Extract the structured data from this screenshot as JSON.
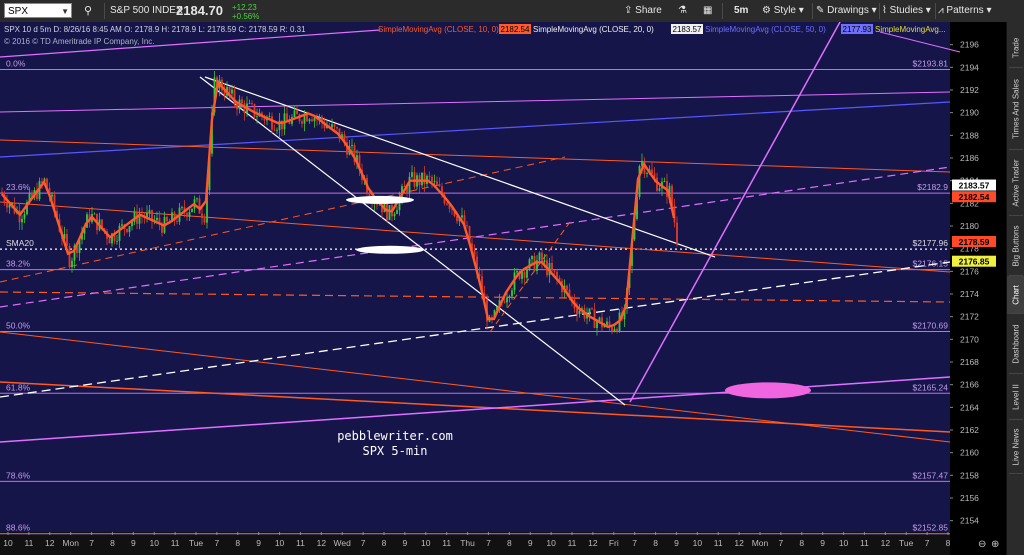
{
  "toolbar": {
    "symbol": "SPX",
    "index_name": "S&P 500 INDEX",
    "last_price": "2184.70",
    "change": "+12.23",
    "change_pct": "+0.56%",
    "share_label": "Share",
    "interval": "5m",
    "style_label": "Style",
    "drawings_label": "Drawings",
    "studies_label": "Studies",
    "patterns_label": "Patterns"
  },
  "side_tabs": [
    "Trade",
    "Times And Sales",
    "Active Trader",
    "Big Buttons",
    "Chart",
    "Dashboard",
    "Level II",
    "Live News"
  ],
  "chart_data": {
    "type": "candlestick",
    "info_line": "SPX 10 d 5m   D: 8/26/16 8:45 AM   O: 2178.9   H: 2178.9   L: 2178.59   C: 2178.59   R: 0.31",
    "copyright": "© 2016 © TD Ameritrade IP Company, Inc.",
    "studies": [
      {
        "label": "SimpleMovingAvg (CLOSE, 10, 0)",
        "value": "2182.54",
        "color": "#ff5a28"
      },
      {
        "label": "SimpleMovingAvg (CLOSE, 20, 0)",
        "value": "2183.57",
        "color": "#f0f0f0"
      },
      {
        "label": "SimpleMovingAvg (CLOSE, 50, 0)",
        "value": "2177.93",
        "color": "#6f6fff"
      },
      {
        "label": "SimpleMovingAvg...",
        "value": "",
        "color": "#e0e030"
      }
    ],
    "y_range": [
      2153,
      2198
    ],
    "y_ticks": [
      2154,
      2156,
      2158,
      2160,
      2162,
      2164,
      2166,
      2168,
      2170,
      2172,
      2174,
      2176,
      2178,
      2180,
      2182,
      2184,
      2186,
      2188,
      2190,
      2192,
      2194,
      2196
    ],
    "x_ticks": [
      "10",
      "11",
      "12",
      "Mon",
      "7",
      "8",
      "9",
      "10",
      "11",
      "Tue",
      "7",
      "8",
      "9",
      "10",
      "11",
      "12",
      "Wed",
      "7",
      "8",
      "9",
      "10",
      "11",
      "Thu",
      "7",
      "8",
      "9",
      "10",
      "11",
      "12",
      "Fri",
      "7",
      "8",
      "9",
      "10",
      "11",
      "12",
      "Mon",
      "7",
      "8",
      "9",
      "10",
      "11",
      "12",
      "Tue",
      "7",
      "8"
    ],
    "fib_levels": [
      {
        "label": "0.0%",
        "price": "$2193.81",
        "y": 2193.81
      },
      {
        "label": "23.6%",
        "price": "$2182.9",
        "y": 2182.9
      },
      {
        "label": "38.2%",
        "price": "$2176.15",
        "y": 2176.15
      },
      {
        "label": "50.0%",
        "price": "$2170.69",
        "y": 2170.69
      },
      {
        "label": "61.8%",
        "price": "$2165.24",
        "y": 2165.24
      },
      {
        "label": "78.6%",
        "price": "$2157.47",
        "y": 2157.47
      },
      {
        "label": "88.6%",
        "price": "$2152.85",
        "y": 2152.85
      }
    ],
    "extra_levels": [
      {
        "label": "SMA20",
        "price": "$2177.96",
        "y": 2177.96
      }
    ],
    "price_tags": [
      {
        "value": "2183.57",
        "y": 2183.57,
        "bg": "#ffffff",
        "fg": "#000000"
      },
      {
        "value": "2182.54",
        "y": 2182.54,
        "bg": "#ff4a2a",
        "fg": "#000000"
      },
      {
        "value": "2178.59",
        "y": 2178.59,
        "bg": "#ff4a2a",
        "fg": "#000000"
      },
      {
        "value": "2176.85",
        "y": 2176.85,
        "bg": "#f0f040",
        "fg": "#000000"
      }
    ],
    "watermark": [
      "pebblewriter.com",
      "SPX 5-min"
    ],
    "colors": {
      "background": "#15154a",
      "up": "#3cc83c",
      "down": "#e03a2a",
      "fib": "#c070e0",
      "sma10": "#ff5a28",
      "sma20": "#f0f0f0",
      "sma50": "#6f6fff",
      "sma_yellow": "#e0e030",
      "trend_pink": "#e070ff",
      "trend_orange": "#ff5a20"
    }
  }
}
